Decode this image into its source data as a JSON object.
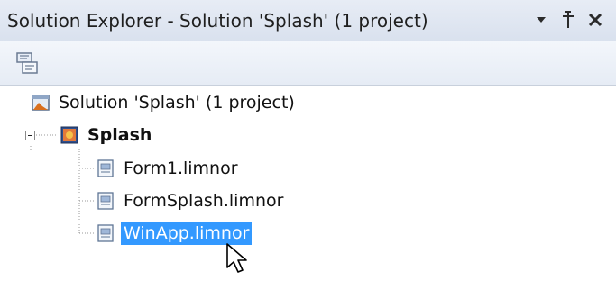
{
  "panel": {
    "title": "Solution Explorer - Solution 'Splash' (1 project)"
  },
  "titlebar_buttons": [
    {
      "icon": "dropdown-arrow-icon"
    },
    {
      "icon": "pin-icon"
    },
    {
      "icon": "close-icon"
    }
  ],
  "toolbar": {
    "icon": "properties-icon"
  },
  "tree": {
    "solution_label": "Solution 'Splash' (1 project)",
    "project_label": "Splash",
    "files": [
      {
        "label": "Form1.limnor",
        "selected": false
      },
      {
        "label": "FormSplash.limnor",
        "selected": false
      },
      {
        "label": "WinApp.limnor",
        "selected": true
      }
    ]
  },
  "colors": {
    "selection": "#3399ff",
    "titlebar": "#dfe6f1"
  }
}
